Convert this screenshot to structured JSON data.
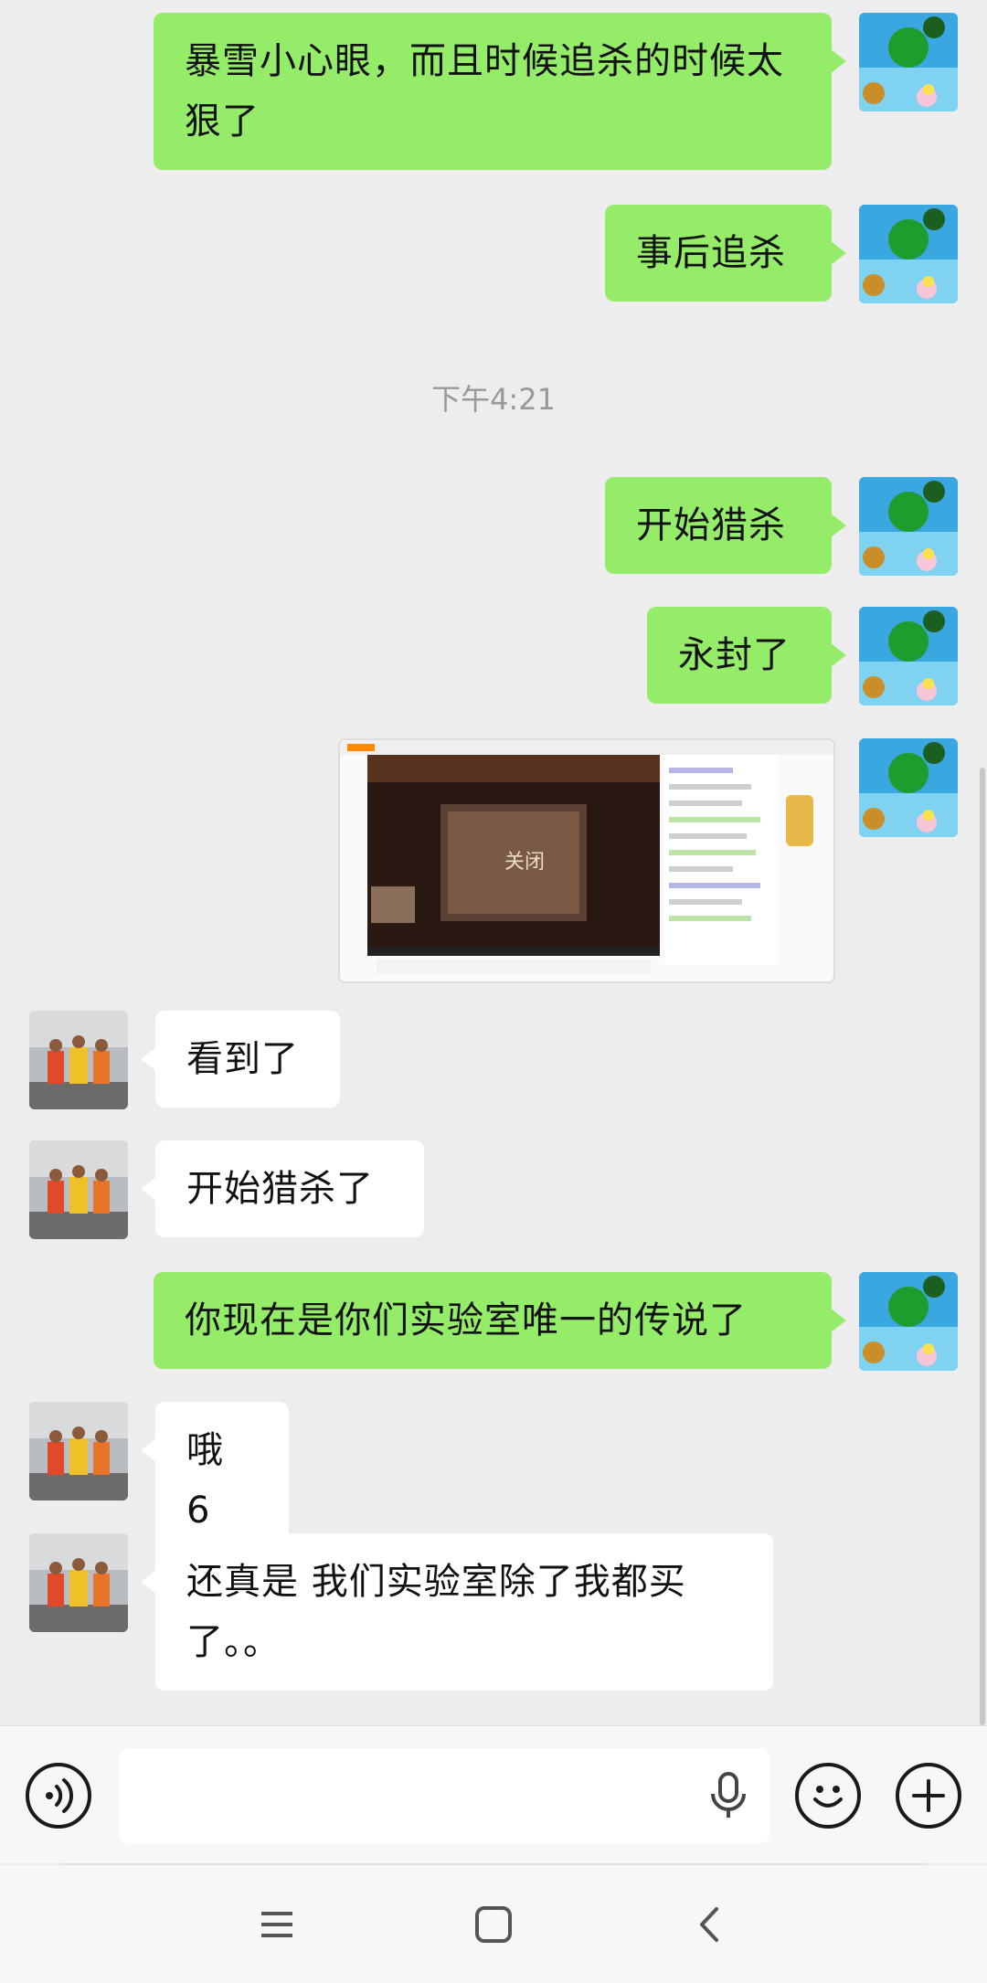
{
  "messages": [
    {
      "side": "me",
      "text": "暴雪小心眼，而且时候追杀的时候太狠了"
    },
    {
      "side": "me",
      "text": "事后追杀"
    },
    {
      "type": "time",
      "text": "下午4:21"
    },
    {
      "side": "me",
      "text": "开始猎杀"
    },
    {
      "side": "me",
      "text": "永封了"
    },
    {
      "side": "me",
      "type": "image",
      "caption": "关闭"
    },
    {
      "side": "other",
      "text": "看到了"
    },
    {
      "side": "other",
      "text": "开始猎杀了"
    },
    {
      "side": "me",
      "text": "你现在是你们实验室唯一的传说了"
    },
    {
      "side": "other",
      "text": "哦 6"
    },
    {
      "side": "other",
      "text": "还真是 我们实验室除了我都买了。。"
    }
  ],
  "colors": {
    "background": "#ededed",
    "my_bubble": "#95ec69",
    "other_bubble": "#ffffff",
    "timestamp": "#999999"
  },
  "input_bar": {
    "placeholder": "",
    "icons": [
      "voice-mode-icon",
      "microphone-icon",
      "emoji-icon",
      "plus-icon"
    ]
  },
  "nav": {
    "icons": [
      "menu-icon",
      "home-icon",
      "back-icon"
    ]
  }
}
